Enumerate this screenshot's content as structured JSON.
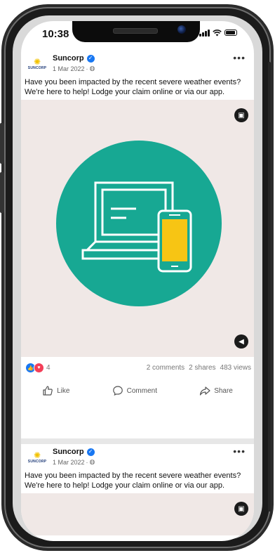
{
  "status_bar": {
    "time": "10:38"
  },
  "posts": [
    {
      "author": "Suncorp",
      "logo_text": "SUNCORP",
      "date": "1 Mar 2022",
      "text": "Have you been impacted by the recent severe weather events? We're here to help! Lodge your claim online or via our app.",
      "reaction_count": "4",
      "comments": "2 comments",
      "shares": "2 shares",
      "views": "483 views"
    },
    {
      "author": "Suncorp",
      "logo_text": "SUNCORP",
      "date": "1 Mar 2022",
      "text": "Have you been impacted by the recent severe weather events? We're here to help! Lodge your claim online or via our app."
    }
  ],
  "actions": {
    "like": "Like",
    "comment": "Comment",
    "share": "Share"
  },
  "icons": {
    "verified": "verified-badge-icon",
    "globe": "globe-icon",
    "more": "more-options-icon",
    "media_top": "picture-in-picture-icon",
    "media_bottom": "volume-icon",
    "like": "thumb-up-icon",
    "comment": "comment-bubble-icon",
    "share": "share-arrow-icon"
  },
  "colors": {
    "media_bg": "#f0e8e6",
    "circle": "#17a893",
    "phone_accent": "#f7c514",
    "facebook_blue": "#1877f2",
    "love_red": "#f33e58"
  }
}
